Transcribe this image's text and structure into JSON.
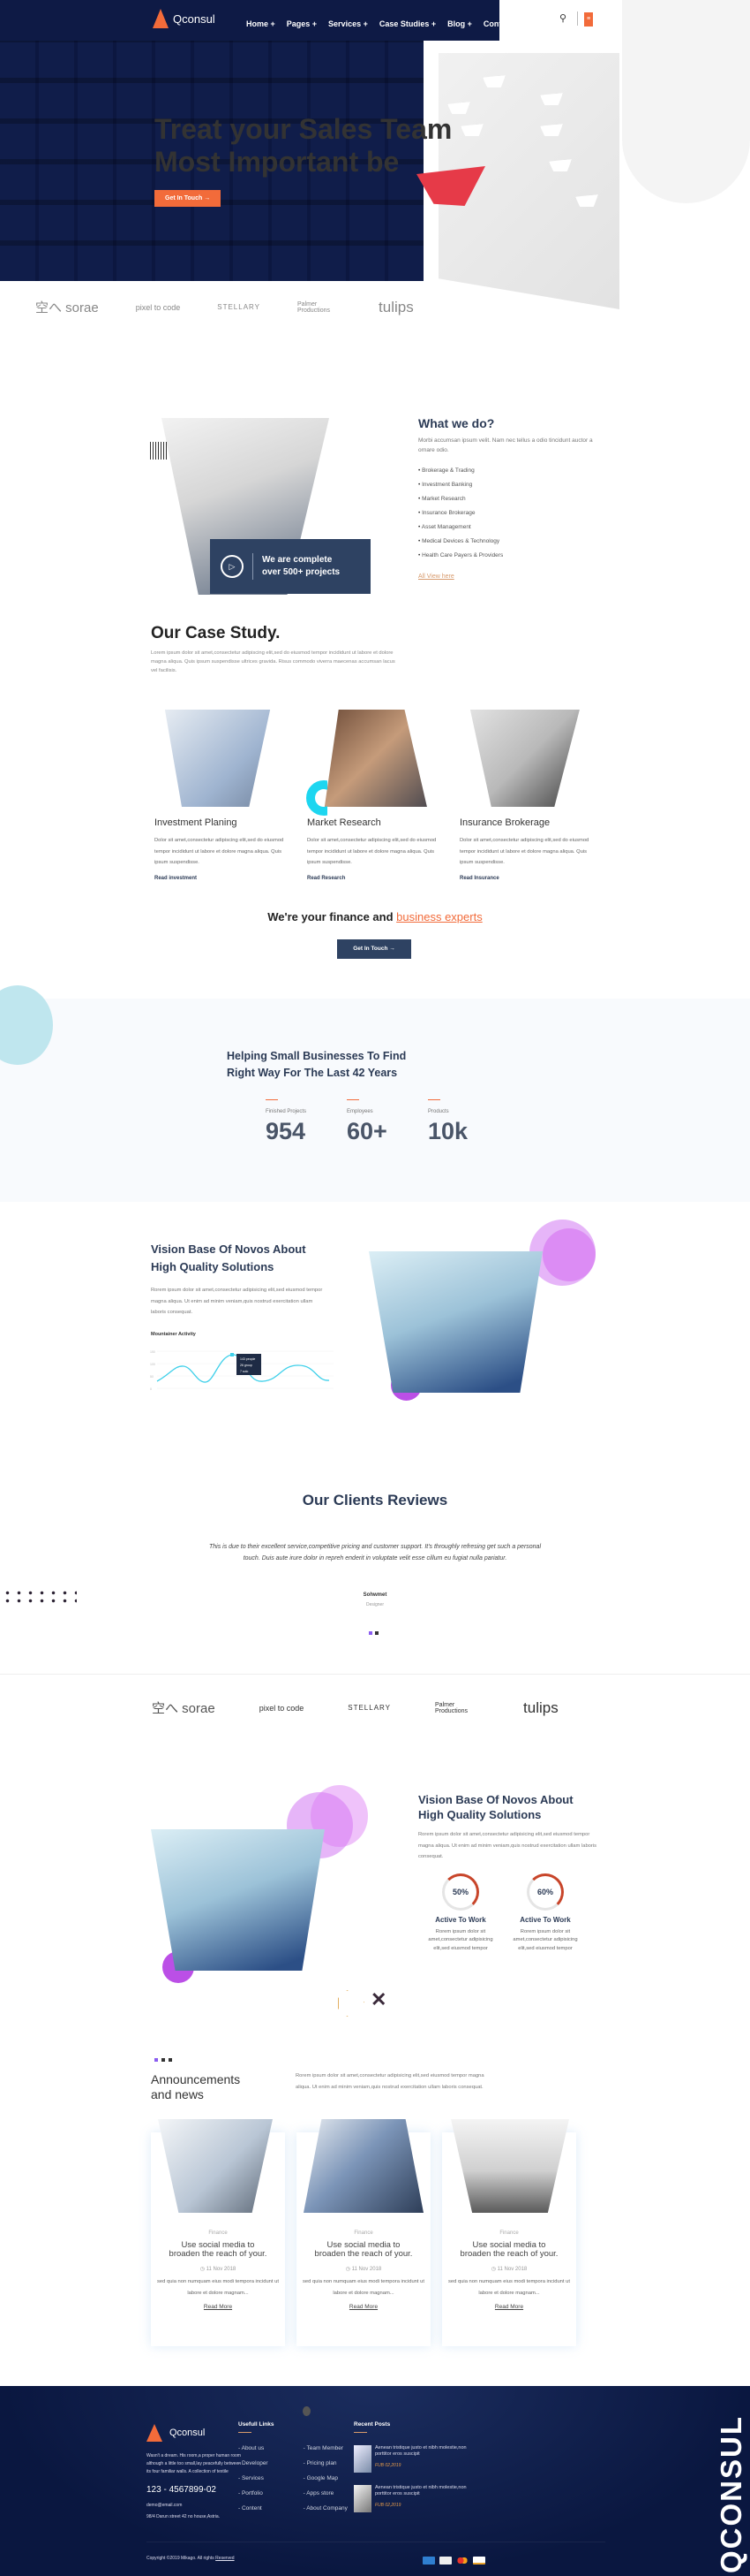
{
  "header": {
    "brand": "Qconsul",
    "nav": [
      "Home +",
      "Pages +",
      "Services +",
      "Case Studies +",
      "Blog +",
      "Contact"
    ],
    "menu_icon": "hamburger-icon",
    "search_icon": "search-icon"
  },
  "hero": {
    "title_line1": "Treat your Sales Team",
    "title_line2": "Most Important be",
    "button": "Get In Touch →"
  },
  "partners": [
    "空へ sorae",
    "pixel to code",
    "STELLARY",
    "Palmer Productions",
    "tulips"
  ],
  "about": {
    "badge": "We are complete over 500+ projects",
    "title": "What we do?",
    "text": "Morbi accumsan ipsum velit. Nam nec tellus a odio tincidunt auctor a ornare odio.",
    "services": [
      "Brokerage & Trading",
      "Investment Banking",
      "Market Research",
      "Insurance Brokerage",
      "Asset Management",
      "Medical Devices & Technology",
      "Health Care Payers & Providers"
    ],
    "link": "All View here"
  },
  "cases": {
    "title": "Our Case Study.",
    "text": "Lorem ipsum dolor sit amet,consectetur adipiscing elit,sed do eiusmod tempor incididunt ut labore et dolore magna aliqua. Quis ipsum suspendisse ultrices gravida. Risus commodo viverra maecenas accumsan lacus vel facilisis.",
    "items": [
      {
        "title": "Investment Planing",
        "text": "Dolor sit amet,consectetur adipiscing elit,sed do eiusmod tempor incididunt ut labore et dolore magna aliqua. Quis ipsum suspendisse.",
        "link": "Read investment"
      },
      {
        "title": "Market Research",
        "text": "Dolor sit amet,consectetur adipiscing elit,sed do eiusmod tempor incididunt ut labore et dolore magna aliqua. Quis ipsum suspendisse.",
        "link": "Read Research"
      },
      {
        "title": "Insurance Brokerage",
        "text": "Dolor sit amet,consectetur adipiscing elit,sed do eiusmod tempor incididunt ut labore et dolore magna aliqua. Quis ipsum suspendisse.",
        "link": "Read Insurance"
      }
    ],
    "cta_text": "We're your finance and ",
    "cta_highlight": "business experts",
    "cta_button": "Get In Touch →"
  },
  "stats": {
    "title_line1": "Helping Small Businesses To Find",
    "title_line2": "Right Way For The Last 42 Years",
    "items": [
      {
        "label": "Finished Projects",
        "value": "954"
      },
      {
        "label": "Employees",
        "value": "60+"
      },
      {
        "label": "Products",
        "value": "10k"
      }
    ]
  },
  "vision": {
    "title_line1": "Vision Base Of Novos About",
    "title_line2": "High Quality Solutions",
    "text": "Rorem ipsum dolor sit amet,consectetur adipisicing elit,sed eiusmod tempor magna aliqua. Ut enim ad minim veniam,quis nostrud exercitation ullam laboris consequat.",
    "chart": {
      "title": "Mountainer Activity",
      "y_ticks": [
        "150",
        "100",
        "50",
        "0"
      ],
      "tooltip": [
        "143  people",
        "26  group",
        "7  solo"
      ],
      "color": "#3fd0ea"
    }
  },
  "reviews": {
    "title": "Our Clients Reviews",
    "quote": "This is due to their excellent service,competitive pricing and customer support. It's throughly refresing get such a personal touch. Duis aute irure dolor in repreh enderit in voluptate velit esse cillum eu fugiat nulla pariatur.",
    "name": "Sohwmet",
    "role": "Designer"
  },
  "vision2": {
    "title_line1": "Vision Base Of Novos About",
    "title_line2": "High Quality Solutions",
    "text": "Rorem ipsum dolor sit amet,consectetur adipisicing elit,sed eiusmod tempor magna aliqua. Ut enim ad minim veniam,quis nostrud exercitation ullam laboris consequat.",
    "progress": [
      {
        "value": 50,
        "label": "50%",
        "title": "Active To Work",
        "text": "Rorem ipsum dolor sit amet,consectetur adipisicing elit,sed eiusmod tempor"
      },
      {
        "value": 60,
        "label": "60%",
        "title": "Active To Work",
        "text": "Rorem ipsum dolor sit amet,consectetur adipisicing elit,sed eiusmod tempor"
      }
    ]
  },
  "news": {
    "title_line1": "Announcements",
    "title_line2": "and news",
    "text": "Rorem ipsum dolor sit amet,consectetur adipisicing elit,sed eiusmod tempor magna aliqua. Ut enim ad minim veniam,quis nostrud exercitation ullam laboris consequat.",
    "items": [
      {
        "category": "Finance",
        "title": "Use social media to broaden the reach of your.",
        "date": "11 Nov 2018",
        "text": "sed quia non numquam eius modi tempora incidunt ut labore et dolore magnam...",
        "link": "Read More"
      },
      {
        "category": "Finance",
        "title": "Use social media to broaden the reach of your.",
        "date": "11 Nov 2018",
        "text": "sed quia non numquam eius modi tempora incidunt ut labore et dolore magnam...",
        "link": "Read More"
      },
      {
        "category": "Finance",
        "title": "Use social media to broaden the reach of your.",
        "date": "11 Nov 2018",
        "text": "sed quia non numquam eius modi tempora incidunt ut labore et dolore magnam...",
        "link": "Read More"
      }
    ]
  },
  "footer": {
    "brand": "Qconsul",
    "about": "Wasn't a dream. His room,a proper human room although a little too small,lay peacefully between its four familiar walls. A collection of textile",
    "phone": "123 - 4567899-02",
    "email": "demo@email.com",
    "address": "98/4 Darun street 42 no house,Astria.",
    "links_title": "Usefull Links",
    "links_col1": [
      "- About us",
      "- Developer",
      "- Services",
      "- Portfolio",
      "- Content"
    ],
    "links_col2": [
      "- Team Member",
      "- Pricing plan",
      "- Google Map",
      "- Apps store",
      "- About Company"
    ],
    "posts_title": "Recent Posts",
    "posts": [
      {
        "title": "Aenean tristique justo et nibh molestie,non porttitor eros suscipit",
        "date": "FUB 02,2019"
      },
      {
        "title": "Aenean tristique justo et nibh molestie,non porttitor eros suscipit",
        "date": "FUB 02,2019"
      }
    ],
    "copyright": "Copyright ©2019 Mikago. All rights ",
    "copyright_link": "Reserved",
    "watermark": "QCONSUL",
    "payments": [
      "amex",
      "discover",
      "mastercard",
      "visa"
    ]
  },
  "colors": {
    "accent": "#f26b3a",
    "navy": "#0e1a45",
    "heading": "#2b3a55",
    "cyan": "#3fd0ea",
    "purple": "#c85af0"
  }
}
